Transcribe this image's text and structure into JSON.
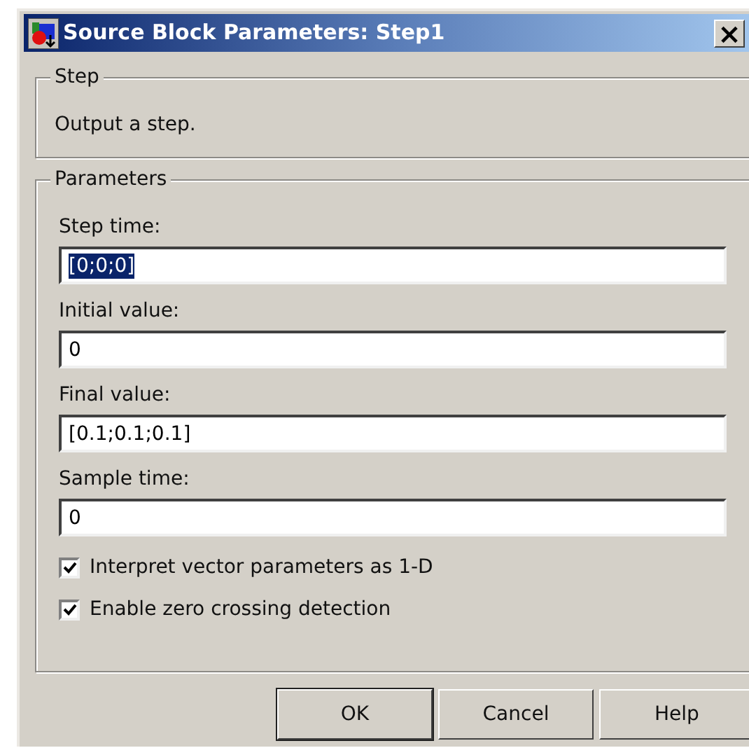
{
  "window": {
    "title": "Source Block Parameters: Step1",
    "close": "×"
  },
  "description_group": {
    "title": "Step",
    "text": "Output a step."
  },
  "parameters_group": {
    "title": "Parameters",
    "fields": [
      {
        "label": "Step time:",
        "value": "[0;0;0]",
        "text_selected": true
      },
      {
        "label": "Initial value:",
        "value": "0",
        "text_selected": false
      },
      {
        "label": "Final value:",
        "value": "[0.1;0.1;0.1]",
        "text_selected": false
      },
      {
        "label": "Sample time:",
        "value": "0",
        "text_selected": false
      }
    ],
    "checkboxes": [
      {
        "label": "Interpret vector parameters as 1-D",
        "checked": true
      },
      {
        "label": "Enable zero crossing detection",
        "checked": true
      }
    ]
  },
  "buttons": [
    "OK",
    "Cancel",
    "Help"
  ]
}
